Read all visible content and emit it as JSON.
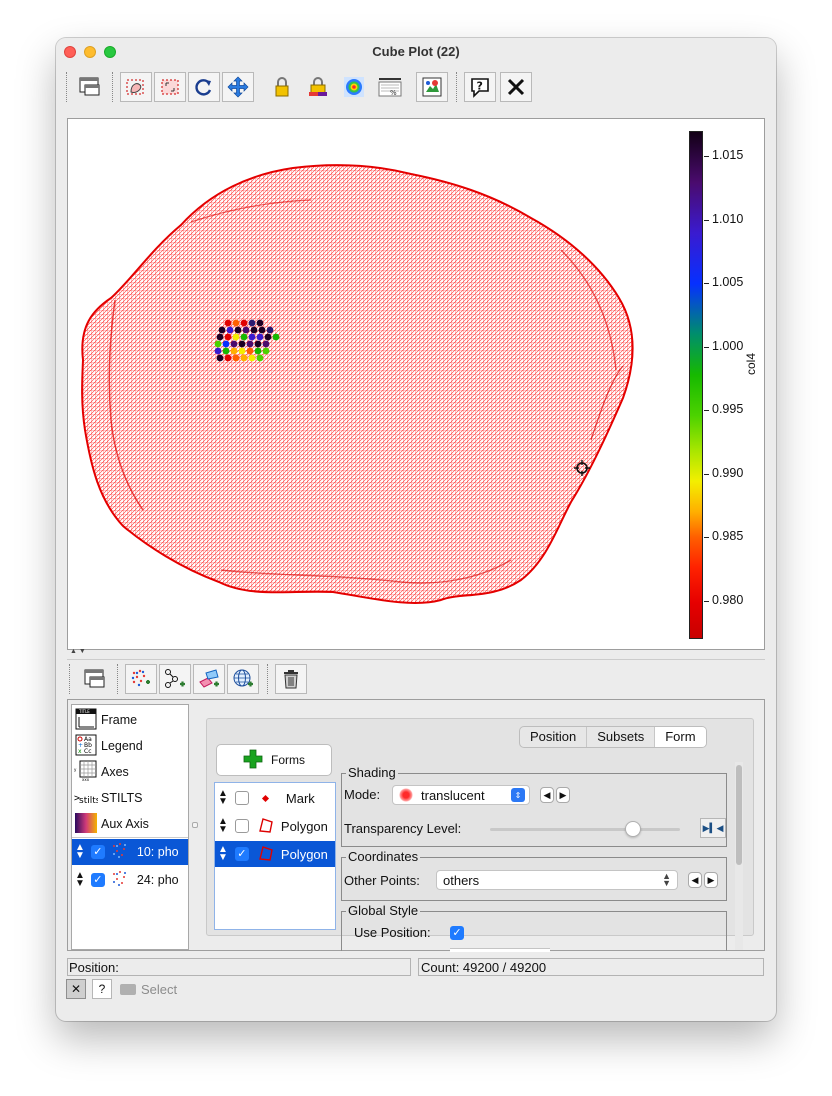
{
  "window": {
    "title": "Cube Plot (22)"
  },
  "toolbar": {
    "buttons": [
      "window-icon",
      "zoom-in-icon",
      "zoom-region-icon",
      "rotate-icon",
      "pan-icon",
      "lock-icon",
      "lock-aux-icon",
      "heatmap-icon",
      "legend-toggle-icon",
      "export-icon",
      "help-icon",
      "close-icon"
    ]
  },
  "colorbar": {
    "title": "col4",
    "ticks": [
      "1.015",
      "1.010",
      "1.005",
      "1.000",
      "0.995",
      "0.990",
      "0.985",
      "0.980"
    ],
    "range": [
      0.977,
      1.017
    ]
  },
  "layer_toolbar": {
    "buttons": [
      "float-window-icon",
      "add-position-layer-icon",
      "add-pair-layer-icon",
      "add-area-layer-icon",
      "add-sky-layer-icon",
      "delete-layer-icon"
    ]
  },
  "layers": {
    "fixed": [
      {
        "label": "Frame",
        "icon": "frame-icon"
      },
      {
        "label": "Legend",
        "icon": "legend-icon"
      },
      {
        "label": "Axes",
        "icon": "axes-icon"
      },
      {
        "label": "STILTS",
        "icon": "stilts-icon"
      },
      {
        "label": "Aux Axis",
        "icon": "aux-axis-icon"
      }
    ],
    "data": [
      {
        "label": "10: pho",
        "checked": true,
        "selected": true
      },
      {
        "label": "24: pho",
        "checked": true,
        "selected": false
      }
    ]
  },
  "tabs": [
    {
      "label": "Position",
      "active": false
    },
    {
      "label": "Subsets",
      "active": false
    },
    {
      "label": "Form",
      "active": true
    }
  ],
  "forms": {
    "button_label": "Forms",
    "items": [
      {
        "label": "Mark",
        "checked": false,
        "selected": false
      },
      {
        "label": "Polygon",
        "checked": false,
        "selected": false
      },
      {
        "label": "Polygon",
        "checked": true,
        "selected": true
      }
    ]
  },
  "shading": {
    "legend": "Shading",
    "mode_label": "Mode:",
    "mode_value": "translucent",
    "transparency_label": "Transparency Level:",
    "transparency_fraction": 0.75
  },
  "coordinates": {
    "legend": "Coordinates",
    "other_points_label": "Other Points:",
    "other_points_value": "others"
  },
  "global_style": {
    "legend": "Global Style",
    "use_position_label": "Use Position:",
    "use_position_checked": true
  },
  "status": {
    "position_label": "Position:",
    "count_text": "Count: 49200 / 49200"
  },
  "bottom": {
    "cancel_icon": "✕",
    "help_label": "?",
    "select_label": "Select"
  }
}
